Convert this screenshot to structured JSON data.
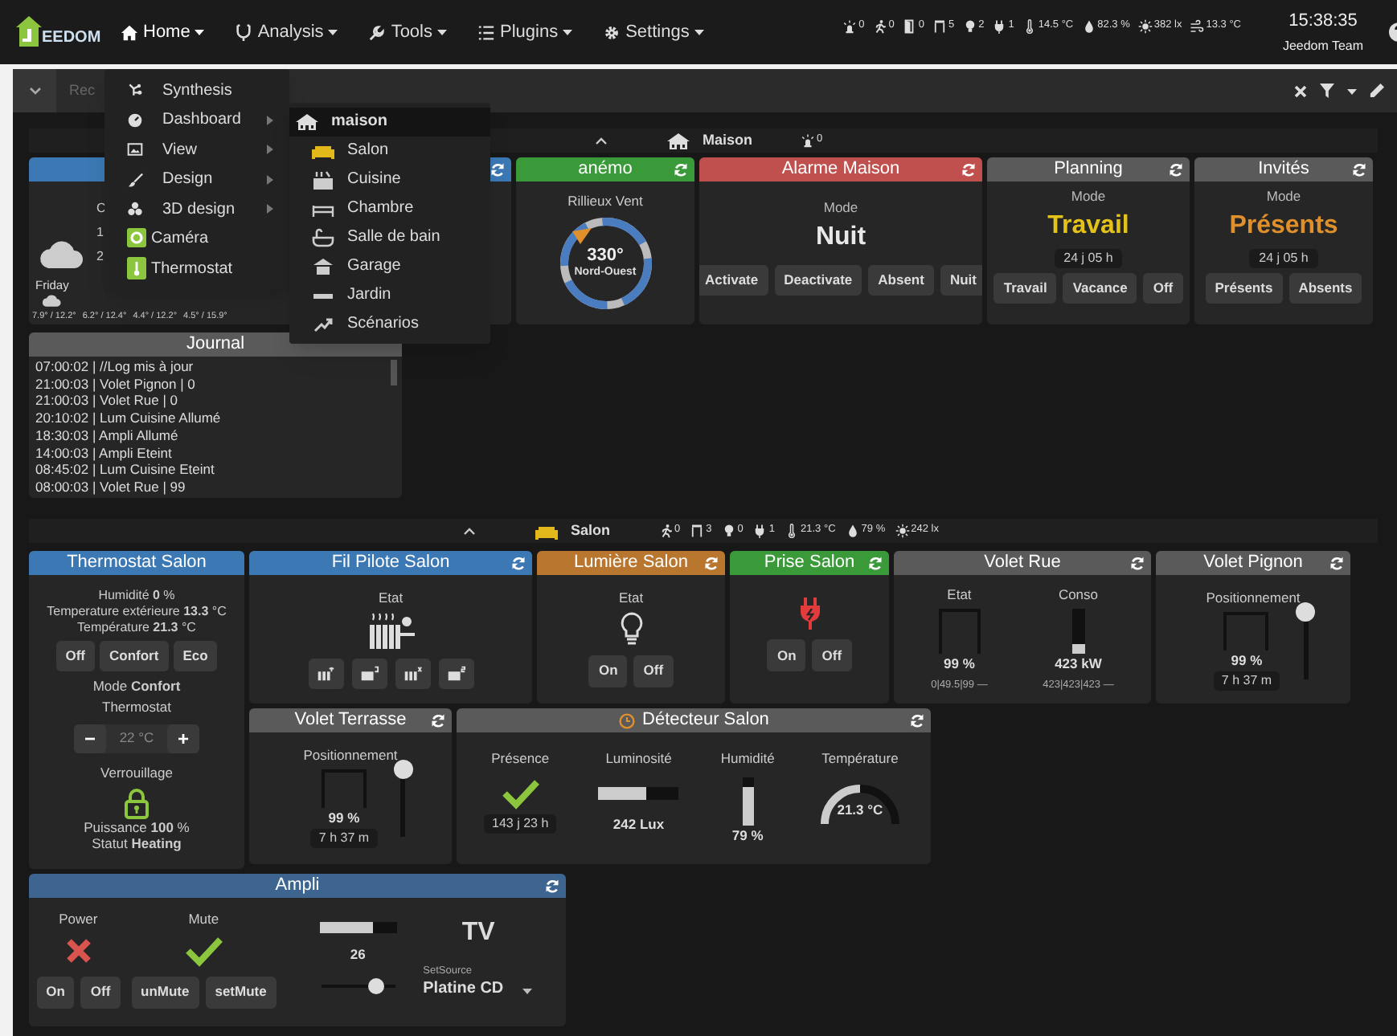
{
  "navbar": {
    "logo": "EEDOM",
    "menus": [
      {
        "label": "Home",
        "expanded": true
      },
      {
        "label": "Analysis",
        "expanded": false
      },
      {
        "label": "Tools",
        "expanded": false
      },
      {
        "label": "Plugins",
        "expanded": false
      },
      {
        "label": "Settings",
        "expanded": false
      }
    ],
    "summary": [
      {
        "kind": "siren",
        "value": "0"
      },
      {
        "kind": "motion",
        "value": "0"
      },
      {
        "kind": "door",
        "value": "0"
      },
      {
        "kind": "window",
        "value": "5"
      },
      {
        "kind": "bulb",
        "value": "2"
      },
      {
        "kind": "plug",
        "value": "1"
      },
      {
        "kind": "thermometer",
        "value": "14.5 °C"
      },
      {
        "kind": "drop",
        "value": "82.3 %"
      },
      {
        "kind": "sun",
        "value": "382 lx"
      },
      {
        "kind": "wind",
        "value": "13.3 °C"
      }
    ],
    "clock": "15:38:35",
    "user": "Jeedom Team"
  },
  "home_menu": [
    {
      "label": "Synthesis",
      "kind": "link"
    },
    {
      "label": "Dashboard",
      "kind": "submenu",
      "submenu": [
        {
          "label": "maison",
          "selected": true
        },
        {
          "label": "Salon",
          "selected": false
        },
        {
          "label": "Cuisine",
          "selected": false
        },
        {
          "label": "Chambre",
          "selected": false
        },
        {
          "label": "Salle de bain",
          "selected": false
        },
        {
          "label": "Garage",
          "selected": false
        },
        {
          "label": "Jardin",
          "selected": false
        },
        {
          "label": "Scénarios",
          "selected": false
        }
      ]
    },
    {
      "label": "View",
      "kind": "submenu"
    },
    {
      "label": "Design",
      "kind": "submenu"
    },
    {
      "label": "3D design",
      "kind": "submenu"
    },
    {
      "label": "Caméra",
      "kind": "plugin"
    },
    {
      "label": "Thermostat",
      "kind": "plugin"
    }
  ],
  "toolbar": {
    "placeholder": "Rec"
  },
  "maison": {
    "title": "Maison",
    "summary": [
      {
        "kind": "siren",
        "value": "0"
      }
    ],
    "weather": {
      "color": "#3b78b4",
      "lines": [
        "C",
        "1",
        "2"
      ],
      "day": "Friday",
      "forecast": [
        "7.9° / 12.2°",
        "6.2° / 12.4°",
        "4.4° / 12.2°",
        "4.5° / 15.9°"
      ]
    },
    "covered": {
      "color": "#3b78b4"
    },
    "anemo": {
      "title": "anémo",
      "color": "#3a9a3a",
      "label": "Rillieux Vent",
      "degrees": "330°",
      "direction": "Nord-Ouest"
    },
    "modes": [
      {
        "title": "Alarme Maison",
        "color": "#c0504d",
        "mode_label": "Mode",
        "mode": {
          "text": "Nuit",
          "color": "#e8e8e8"
        },
        "buttons": [
          "Activate",
          "Deactivate",
          "Absent",
          "Nuit"
        ]
      },
      {
        "title": "Planning",
        "color": "#5a5a5a",
        "mode_label": "Mode",
        "mode": {
          "text": "Travail",
          "color": "#e3c31a"
        },
        "duration": "24 j 05 h",
        "buttons": [
          "Travail",
          "Vacance",
          "Off"
        ]
      },
      {
        "title": "Invités",
        "color": "#5a5a5a",
        "mode_label": "Mode",
        "mode": {
          "text": "Présents",
          "color": "#e0902a"
        },
        "duration": "24 j 05 h",
        "buttons": [
          "Présents",
          "Absents"
        ]
      }
    ],
    "journal": {
      "title": "Journal",
      "color": "#5a5a5a",
      "lines": [
        "07:00:02 | //Log mis à jour",
        "21:00:03 | Volet Pignon | 0",
        "21:00:03 | Volet Rue | 0",
        "20:10:02 | Lum Cuisine Allumé",
        "18:30:03 | Ampli Allumé",
        "14:00:03 | Ampli Eteint",
        "08:45:02 | Lum Cuisine Eteint",
        "08:00:03 | Volet Rue | 99"
      ]
    }
  },
  "salon": {
    "title": "Salon",
    "summary": [
      {
        "kind": "motion",
        "value": "0"
      },
      {
        "kind": "window",
        "value": "3"
      },
      {
        "kind": "bulb",
        "value": "0"
      },
      {
        "kind": "plug",
        "value": "1"
      },
      {
        "kind": "thermometer",
        "value": "21.3 °C"
      },
      {
        "kind": "drop",
        "value": "79 %"
      },
      {
        "kind": "sun",
        "value": "242 lx"
      }
    ],
    "thermostat": {
      "title": "Thermostat Salon",
      "color": "#3b78b4",
      "lines": [
        "Humidité **0** %",
        "Temperature extérieure **13.3** °C",
        "Température **21.3** °C"
      ],
      "buttons": [
        "Off",
        "Confort",
        "Eco"
      ],
      "mode": "Mode **Confort**",
      "name": "Thermostat",
      "minus": "−",
      "setpoint": "22 °C",
      "plus": "+",
      "lock_label": "Verrouillage",
      "footer": [
        "Puissance **100** %",
        "Statut **Heating**"
      ]
    },
    "fil_pilote": {
      "title": "Fil Pilote Salon",
      "color": "#3b78b4",
      "label": "Etat"
    },
    "lumiere": {
      "title": "Lumière Salon",
      "color": "#b8762e",
      "label": "Etat",
      "on": false,
      "buttons": [
        "On",
        "Off"
      ]
    },
    "prise": {
      "title": "Prise Salon",
      "color": "#3a9a3a",
      "buttons": [
        "On",
        "Off"
      ]
    },
    "volet_rue": {
      "title": "Volet Rue",
      "color": "#5a5a5a",
      "state_label": "Etat",
      "state": "99 %",
      "state_stats": "0|49.5|99 —",
      "conso_label": "Conso",
      "conso": "423 kW",
      "conso_bar": {
        "level": 0.2
      },
      "conso_stats": "423|423|423 —"
    },
    "volet_pignon": {
      "title": "Volet Pignon",
      "color": "#5a5a5a",
      "label": "Positionnement",
      "value": "99 %",
      "duration": "7 h 37 m",
      "level": 0.99
    },
    "volet_terrasse": {
      "title": "Volet Terrasse",
      "color": "#5a5a5a",
      "label": "Positionnement",
      "value": "99 %",
      "duration": "7 h 37 m",
      "level": 0.99
    },
    "detecteur": {
      "title": "Détecteur Salon",
      "color": "#5a5a5a",
      "readings": [
        {
          "kind": "presence",
          "label": "Présence",
          "value": "143 j 23 h"
        },
        {
          "kind": "hbar",
          "label": "Luminosité",
          "value": "242 Lux",
          "level": 0.6
        },
        {
          "kind": "vbar",
          "label": "Humidité",
          "value": "79 %",
          "level": 0.79
        },
        {
          "kind": "gauge",
          "label": "Température",
          "value": "21.3 °C",
          "level": 0.5
        }
      ]
    }
  },
  "ampli": {
    "title": "Ampli",
    "color": "#3d6590",
    "power_label": "Power",
    "power": false,
    "power_buttons": [
      "On",
      "Off"
    ],
    "mute_label": "Mute",
    "mute": true,
    "mute_buttons": [
      "unMute",
      "setMute"
    ],
    "volume_bar": {
      "level": 0.7
    },
    "volume": "26",
    "volume_slider": {
      "level": 0.75
    },
    "source": "TV",
    "source_label": "SetSource",
    "source_select": "Platine CD"
  }
}
